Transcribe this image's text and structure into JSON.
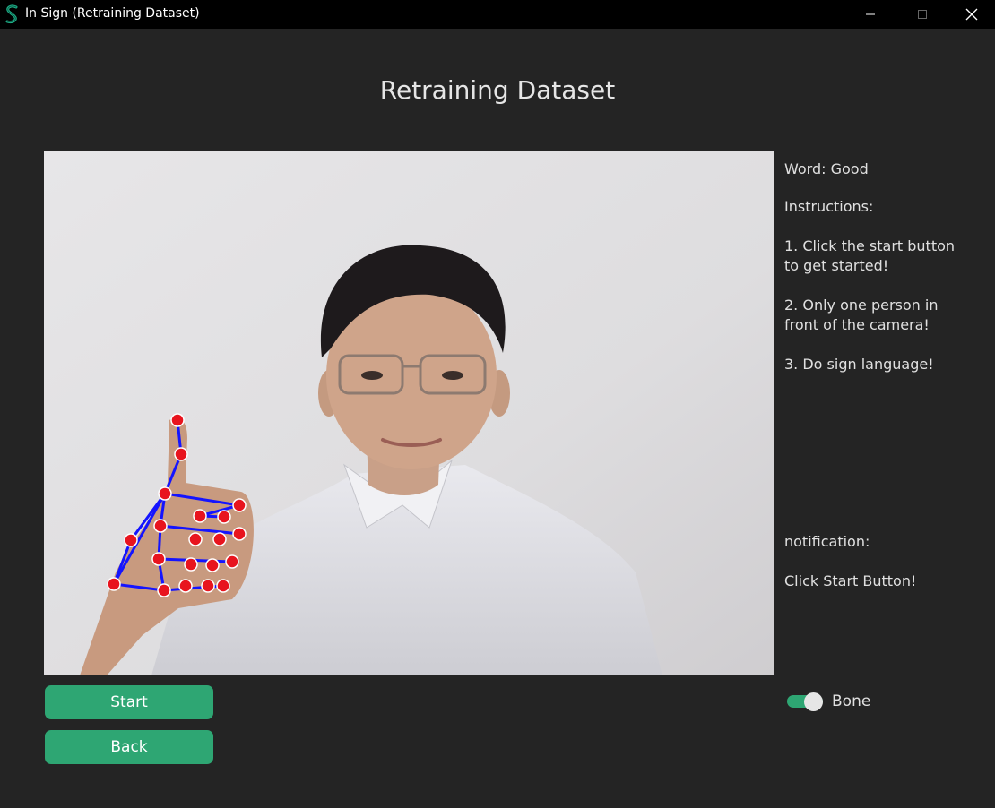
{
  "window": {
    "title": "In Sign (Retraining Dataset)",
    "controls": [
      "minimize-icon",
      "maximize-icon",
      "close-icon"
    ]
  },
  "page": {
    "title": "Retraining Dataset"
  },
  "info": {
    "word": "Word: Good",
    "instructions_title": "Instructions:",
    "instruction_1": "1. Click the start button to get started!",
    "instruction_2": "2. Only one person in front of the camera!",
    "instruction_3": "3. Do sign language!",
    "notification_title": "notification:",
    "notification_message": "Click Start Button!"
  },
  "buttons": {
    "start_label": "Start",
    "back_label": "Back"
  },
  "toggle": {
    "label": "Bone",
    "on": true
  },
  "colors": {
    "accent": "#2ea673",
    "background": "#242424",
    "titlebar": "#000000",
    "landmark_point": "#e8141e",
    "landmark_line": "#1414ff"
  }
}
